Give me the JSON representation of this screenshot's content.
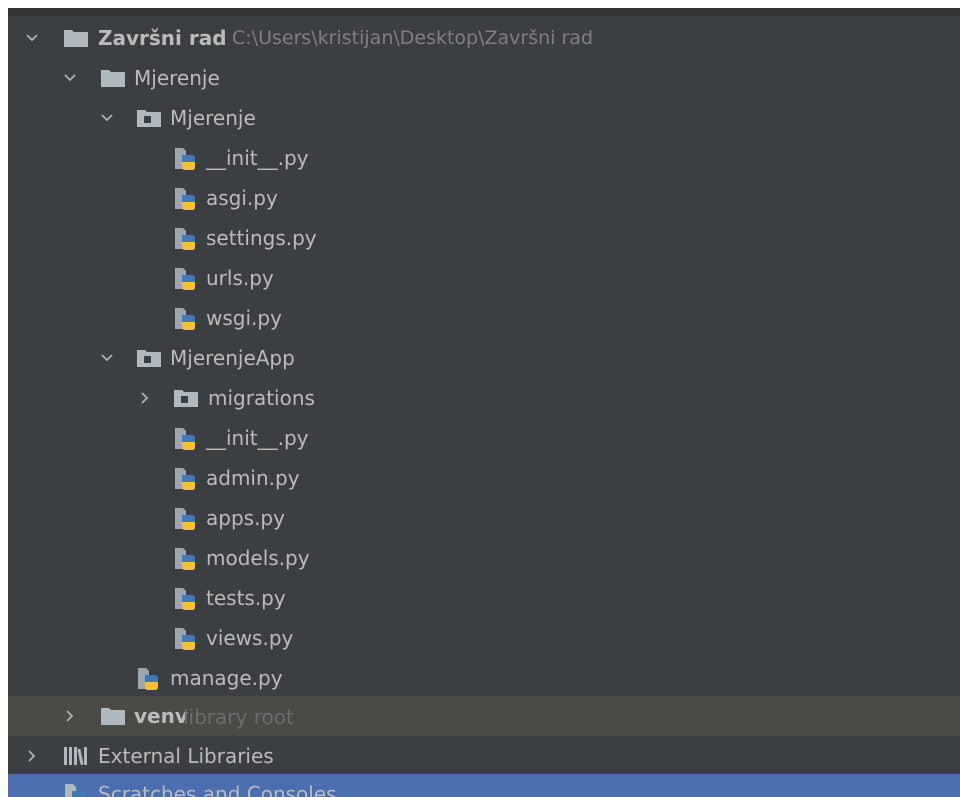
{
  "project": {
    "name": "Završni rad",
    "path": "C:\\Users\\kristijan\\Desktop\\Završni rad"
  },
  "tree": {
    "mjerenje_root": "Mjerenje",
    "mjerenje_pkg": "Mjerenje",
    "mjerenje_files": [
      "__init__.py",
      "asgi.py",
      "settings.py",
      "urls.py",
      "wsgi.py"
    ],
    "app_pkg": "MjerenjeApp",
    "migrations": "migrations",
    "app_files": [
      "__init__.py",
      "admin.py",
      "apps.py",
      "models.py",
      "tests.py",
      "views.py"
    ],
    "manage": "manage.py",
    "venv": "venv",
    "venv_tag": "library root",
    "external_libraries": "External Libraries",
    "scratches": "Scratches and Consoles"
  },
  "colors": {
    "panel_bg": "#3c3f41",
    "text": "#bbbbbb",
    "path_text": "#808080",
    "highlight_row": "#4b4a44",
    "selected_row": "#4b6eaf",
    "folder": "#aeb9c0",
    "python_blue": "#3d7ab8",
    "python_yellow": "#f6c22f"
  },
  "icons": {
    "chevron_expanded": "chevron-down-icon",
    "chevron_collapsed": "chevron-right-icon",
    "folder": "folder-icon",
    "package": "package-folder-icon",
    "python": "python-file-icon",
    "libraries": "libraries-icon"
  }
}
